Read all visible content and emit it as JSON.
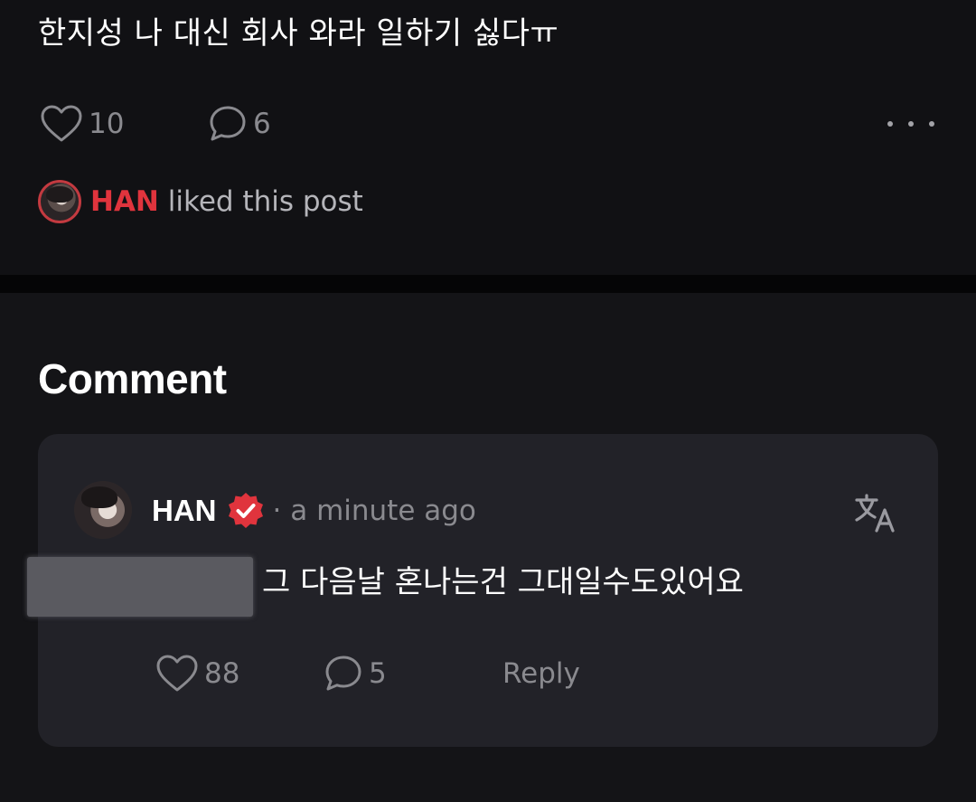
{
  "post": {
    "text": "한지성 나 대신 회사 와라 일하기 싫다ㅠ",
    "like_count": "10",
    "comment_count": "6",
    "liked_by": {
      "name": "HAN",
      "text": "liked this post"
    }
  },
  "comments": {
    "heading": "Comment",
    "items": [
      {
        "author": "HAN",
        "separator": "·",
        "time": "a minute ago",
        "body": "그 다음날 혼나는건 그대일수도있어요",
        "like_count": "88",
        "reply_count": "5",
        "reply_label": "Reply"
      }
    ]
  },
  "colors": {
    "accent": "#e0343d",
    "background": "#0f0f12",
    "card": "#222228",
    "muted_text": "#8a8a8f"
  },
  "icons": [
    "heart-icon",
    "comment-bubble-icon",
    "more-dots-icon",
    "verified-badge-icon",
    "translate-icon"
  ]
}
